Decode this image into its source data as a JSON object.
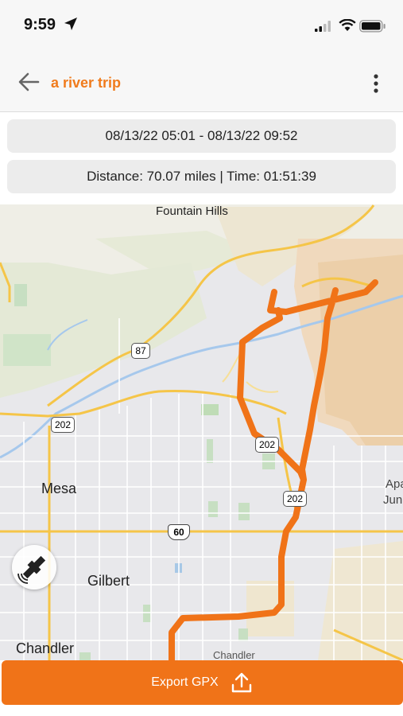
{
  "status_bar": {
    "time": "9:59"
  },
  "header": {
    "title": "a river trip"
  },
  "trip": {
    "date_range": "08/13/22 05:01 - 08/13/22 09:52",
    "summary": "Distance: 70.07 miles | Time: 01:51:39"
  },
  "map": {
    "labels": {
      "fountain_hills": "Fountain Hills",
      "mesa": "Mesa",
      "gilbert": "Gilbert",
      "chandler": "Chandler",
      "chandler_partial": "Chandler",
      "apache_junction_1": "Apa",
      "apache_junction_2": "Jun"
    },
    "shields": {
      "sr87": "87",
      "sr202_a": "202",
      "sr202_b": "202",
      "sr202_c": "202",
      "us60": "60"
    },
    "route_color": "#f07318"
  },
  "export_button": {
    "label": "Export GPX",
    "icon": "upload-icon"
  },
  "colors": {
    "accent": "#f07b1c",
    "button": "#f07318"
  }
}
